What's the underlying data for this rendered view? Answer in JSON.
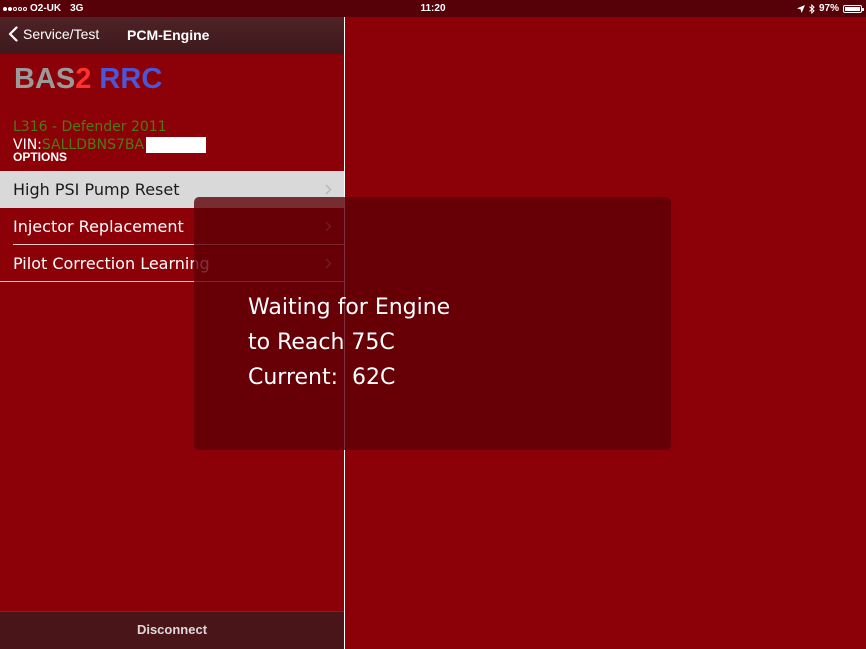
{
  "status_bar": {
    "signal_dots_filled": 2,
    "signal_dots_total": 5,
    "carrier": "O2-UK",
    "network": "3G",
    "time": "11:20",
    "battery_percent_text": "97%",
    "battery_level": 0.97,
    "icons": [
      "location-arrow-icon",
      "bluetooth-icon",
      "battery-icon"
    ]
  },
  "nav": {
    "back_label": "Service/Test",
    "title": "PCM-Engine"
  },
  "brand": {
    "part1": "BAS",
    "part2": "2",
    "part3": " RRC",
    "colors": {
      "bas": "#9a9a9a",
      "two": "#ff3030",
      "rrc": "#4a57d8"
    }
  },
  "vehicle": {
    "model": "L316 - Defender 2011",
    "vin_label": "VIN: ",
    "vin_value": "SALLDBNS7BA"
  },
  "options": {
    "header": "OPTIONS",
    "items": [
      {
        "label": "High PSI Pump Reset",
        "selected": true
      },
      {
        "label": "Injector Replacement",
        "selected": false
      },
      {
        "label": "Pilot Correction Learning",
        "selected": false
      }
    ]
  },
  "footer": {
    "disconnect_label": "Disconnect"
  },
  "hud": {
    "message": "Waiting for Engine\nto Reach 75C\nCurrent:  62C"
  },
  "colors": {
    "background": "#8c0008",
    "accent_green": "#4d7a16",
    "nav_bar": "#3d1a1d"
  }
}
